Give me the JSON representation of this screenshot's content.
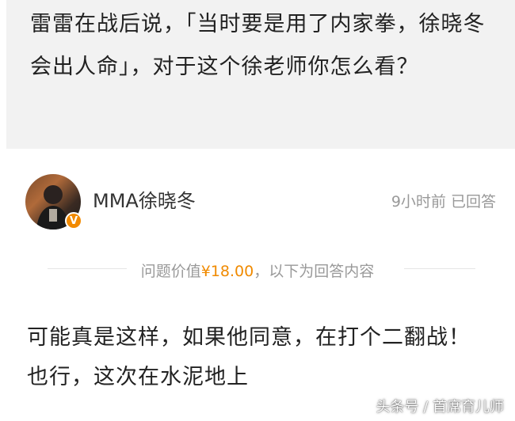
{
  "question": {
    "text": "雷雷在战后说，「当时要是用了内家拳，徐晓冬会出人命」，对于这个徐老师你怎么看？"
  },
  "answer": {
    "author": "MMA徐晓冬",
    "time": "9小时前",
    "status": "已回答",
    "value_prefix": "问题价值",
    "value_amount": "¥18.00",
    "value_suffix": "，以下为回答内容",
    "content": "可能真是这样，如果他同意，在打个二翻战！也行，这次在水泥地上",
    "avatar_icon": "user-avatar-photo",
    "badge_icon": "verified-v-icon"
  },
  "watermark": "头条号 / 首席育儿师",
  "colors": {
    "question_bg": "#f2f2f2",
    "price": "#f08a00",
    "badge": "#f28a00",
    "meta": "#999999"
  }
}
